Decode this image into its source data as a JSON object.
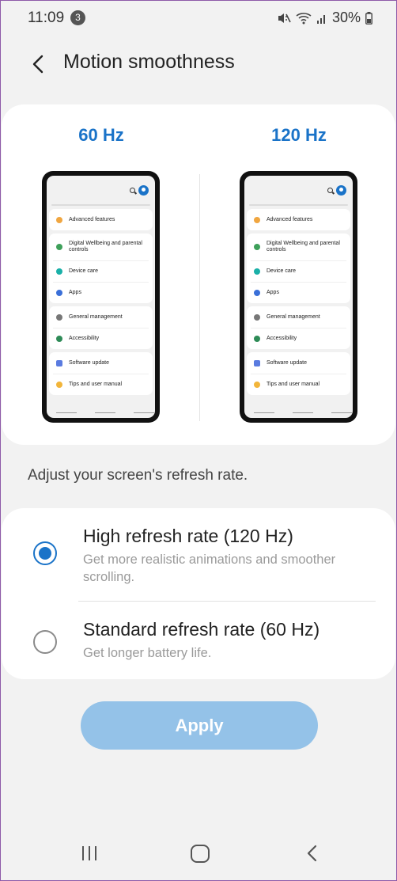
{
  "status": {
    "time": "11:09",
    "notification_count": "3",
    "battery": "30%"
  },
  "header": {
    "title": "Motion smoothness"
  },
  "preview": {
    "left_label": "60 Hz",
    "right_label": "120 Hz",
    "phone_items": {
      "advanced": "Advanced features",
      "wellbeing": "Digital Wellbeing and parental controls",
      "device_care": "Device care",
      "apps": "Apps",
      "general": "General management",
      "accessibility": "Accessibility",
      "software": "Software update",
      "tips": "Tips and user manual"
    }
  },
  "subtitle": "Adjust your screen's refresh rate.",
  "options": {
    "high": {
      "title": "High refresh rate (120 Hz)",
      "desc": "Get more realistic animations and smoother scrolling.",
      "selected": true
    },
    "standard": {
      "title": "Standard refresh rate (60 Hz)",
      "desc": "Get longer battery life.",
      "selected": false
    }
  },
  "apply_label": "Apply",
  "colors": {
    "accent": "#1a73c8",
    "apply_button": "#94c2e8",
    "background": "#f2f2f2"
  }
}
